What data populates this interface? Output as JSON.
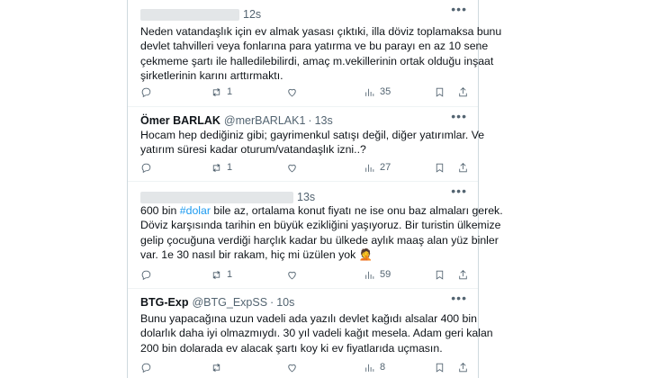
{
  "tweets": [
    {
      "name": "",
      "handle": "",
      "time": "12s",
      "lines": [
        "Neden vatandaşlık için ev almak yasası çıktıki, illa döviz toplamaksa bunu",
        "devlet tahvilleri veya fonlarına para yatırma ve bu parayı en az 10 sene",
        "çekmeme şartı ile halledilebilirdi, amaç m.vekillerinin ortak olduğu inşaat",
        "şirketlerinin karını arttırmaktı."
      ],
      "reply": "",
      "retweet": "1",
      "like": "",
      "views": "35"
    },
    {
      "name": "Ömer BARLAK",
      "handle": "@merBARLAK1",
      "time": "13s",
      "lines": [
        "Hocam hep dediğiniz gibi; gayrimenkul satışı değil, diğer yatırımlar. Ve",
        "yatırım süresi kadar oturum/vatandaşlık izni..?"
      ],
      "reply": "",
      "retweet": "1",
      "like": "",
      "views": "27"
    },
    {
      "name": "",
      "handle": "",
      "time": "13s",
      "hashtag": "#dolar",
      "line0_pre": "600 bin ",
      "line0_post": " bile az, ortalama konut fiyatı ne ise onu baz almaları gerek.",
      "lines": [
        "Döviz karşısında tarihin en büyük ezikliğini yaşıyoruz. Bir turistin ülkemize",
        "gelip çocuğuna verdiği harçlık kadar bu ülkede aylık maaş alan yüz binler",
        "var. 1e 30 nasıl bir rakam, hiç mi üzülen yok "
      ],
      "emoji": "🤦",
      "reply": "",
      "retweet": "1",
      "like": "",
      "views": "59"
    },
    {
      "name": "BTG-Exp",
      "handle": "@BTG_ExpSS",
      "time": "10s",
      "lines": [
        "Bunu yapacağına uzun vadeli ada yazılı devlet kağıdı alsalar 400 bin",
        "dolarlık daha iyi olmazmıydı. 30 yıl vadeli kağıt mesela. Adam geri kalan",
        "200 bin dolarada ev alacak şartı koy ki  ev fiyatlarıda uçmasın."
      ],
      "reply": "",
      "retweet": "",
      "like": "",
      "views": "8"
    }
  ],
  "more_label": "•••",
  "icons": [
    "reply-icon",
    "retweet-icon",
    "like-icon",
    "views-icon",
    "bookmark-icon",
    "share-icon"
  ],
  "colors": {
    "text": "#0f1419",
    "muted": "#536471",
    "link": "#1d9bf0",
    "border": "#cfd9de"
  }
}
